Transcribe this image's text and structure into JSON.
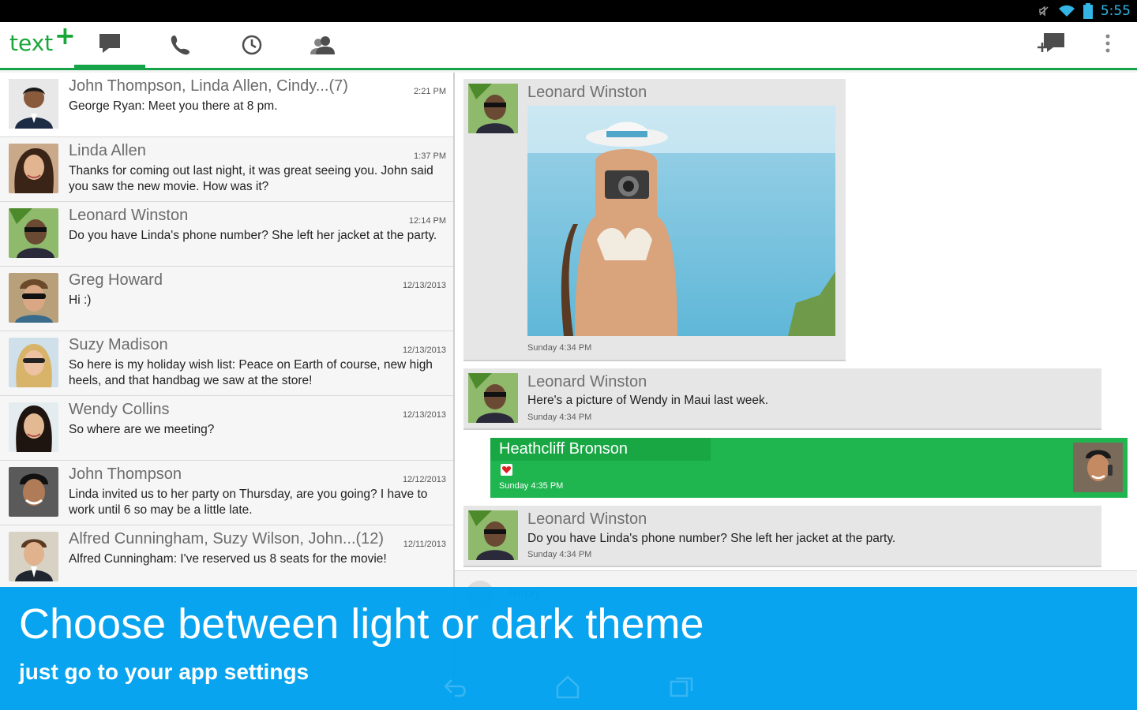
{
  "status": {
    "time": "5:55"
  },
  "app": {
    "logo_text": "text",
    "logo_plus": "+"
  },
  "conversations": [
    {
      "name": "John Thompson, Linda Allen, Cindy...(7)",
      "time": "2:21 PM",
      "message": "George Ryan: Meet you there at 8 pm."
    },
    {
      "name": "Linda Allen",
      "time": "1:37 PM",
      "message": "Thanks for coming out last night, it was great seeing you. John said you saw the new movie. How was it?"
    },
    {
      "name": "Leonard Winston",
      "time": "12:14 PM",
      "message": "Do you have Linda's phone number? She left her jacket at the party."
    },
    {
      "name": "Greg Howard",
      "time": "12/13/2013",
      "message": "Hi :)"
    },
    {
      "name": "Suzy Madison",
      "time": "12/13/2013",
      "message": "So here is my holiday wish list: Peace on Earth of course, new high heels, and that handbag we saw at the store!"
    },
    {
      "name": "Wendy Collins",
      "time": "12/13/2013",
      "message": "So where are we meeting?"
    },
    {
      "name": "John Thompson",
      "time": "12/12/2013",
      "message": "Linda invited us to her party on Thursday, are you going? I have to work until 6 so may be a little late."
    },
    {
      "name": "Alfred Cunningham, Suzy Wilson, John...(12)",
      "time": "12/11/2013",
      "message": "Alfred Cunningham: I've reserved us 8 seats for the movie!"
    }
  ],
  "thread": [
    {
      "sender": "Leonard Winston",
      "text": "",
      "time": "Sunday 4:34 PM"
    },
    {
      "sender": "Leonard Winston",
      "text": "Here's a picture of Wendy in Maui last week.",
      "time": "Sunday 4:34 PM"
    },
    {
      "sender": "Heathcliff Bronson",
      "text": "",
      "time": "Sunday 4:35 PM"
    },
    {
      "sender": "Leonard Winston",
      "text": "Do you have Linda's phone number? She left her jacket at the party.",
      "time": "Sunday 4:34 PM"
    }
  ],
  "composer": {
    "placeholder": "Reply"
  },
  "banner": {
    "headline": "Choose between light or dark theme",
    "subline": "just go to your app settings"
  },
  "colors": {
    "brand_green": "#16a34a",
    "banner_blue": "#00a1ee",
    "status_blue": "#33b5e5"
  }
}
